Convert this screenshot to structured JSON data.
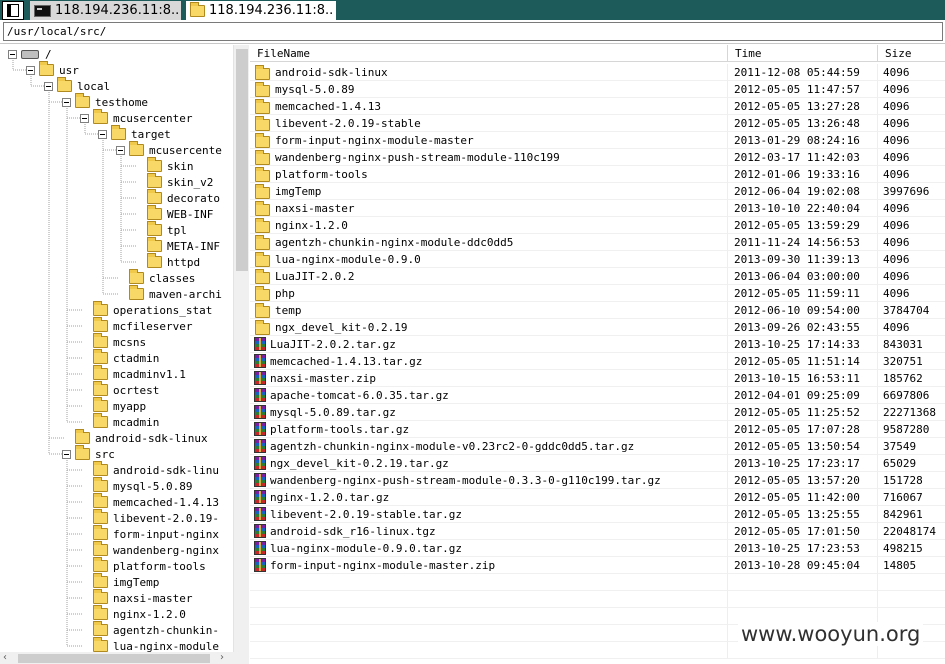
{
  "tabs": [
    {
      "label": "118.194.236.11:8..",
      "icon": "terminal-icon",
      "active": false
    },
    {
      "label": "118.194.236.11:8..",
      "icon": "folder-icon",
      "active": true
    }
  ],
  "path": "/usr/local/src/",
  "tree": [
    {
      "label": "/",
      "depth": 0,
      "expanded": true,
      "icon": "drive-icon"
    },
    {
      "label": "usr",
      "depth": 1,
      "expanded": true
    },
    {
      "label": "local",
      "depth": 2,
      "expanded": true
    },
    {
      "label": "testhome",
      "depth": 3,
      "expanded": true
    },
    {
      "label": "mcusercenter",
      "depth": 4,
      "expanded": true
    },
    {
      "label": "target",
      "depth": 5,
      "expanded": true
    },
    {
      "label": "mcusercente",
      "depth": 6,
      "expanded": true
    },
    {
      "label": "skin",
      "depth": 7
    },
    {
      "label": "skin_v2",
      "depth": 7
    },
    {
      "label": "decorato",
      "depth": 7
    },
    {
      "label": "WEB-INF",
      "depth": 7
    },
    {
      "label": "tpl",
      "depth": 7
    },
    {
      "label": "META-INF",
      "depth": 7
    },
    {
      "label": "httpd",
      "depth": 7
    },
    {
      "label": "classes",
      "depth": 6
    },
    {
      "label": "maven-archi",
      "depth": 6
    },
    {
      "label": "operations_stat",
      "depth": 4
    },
    {
      "label": "mcfileserver",
      "depth": 4
    },
    {
      "label": "mcsns",
      "depth": 4
    },
    {
      "label": "ctadmin",
      "depth": 4
    },
    {
      "label": "mcadminv1.1",
      "depth": 4
    },
    {
      "label": "ocrtest",
      "depth": 4
    },
    {
      "label": "myapp",
      "depth": 4
    },
    {
      "label": "mcadmin",
      "depth": 4
    },
    {
      "label": "android-sdk-linux",
      "depth": 3
    },
    {
      "label": "src",
      "depth": 3,
      "expanded": true
    },
    {
      "label": "android-sdk-linu",
      "depth": 4
    },
    {
      "label": "mysql-5.0.89",
      "depth": 4
    },
    {
      "label": "memcached-1.4.13",
      "depth": 4
    },
    {
      "label": "libevent-2.0.19-",
      "depth": 4
    },
    {
      "label": "form-input-nginx",
      "depth": 4
    },
    {
      "label": "wandenberg-nginx",
      "depth": 4
    },
    {
      "label": "platform-tools",
      "depth": 4
    },
    {
      "label": "imgTemp",
      "depth": 4
    },
    {
      "label": "naxsi-master",
      "depth": 4
    },
    {
      "label": "nginx-1.2.0",
      "depth": 4
    },
    {
      "label": "agentzh-chunkin-",
      "depth": 4
    },
    {
      "label": "lua-nginx-module",
      "depth": 4
    }
  ],
  "columns": {
    "name": "FileName",
    "time": "Time",
    "size": "Size"
  },
  "files": [
    {
      "name": "android-sdk-linux",
      "time": "2011-12-08 05:44:59",
      "size": "4096",
      "type": "folder"
    },
    {
      "name": "mysql-5.0.89",
      "time": "2012-05-05 11:47:57",
      "size": "4096",
      "type": "folder"
    },
    {
      "name": "memcached-1.4.13",
      "time": "2012-05-05 13:27:28",
      "size": "4096",
      "type": "folder"
    },
    {
      "name": "libevent-2.0.19-stable",
      "time": "2012-05-05 13:26:48",
      "size": "4096",
      "type": "folder"
    },
    {
      "name": "form-input-nginx-module-master",
      "time": "2013-01-29 08:24:16",
      "size": "4096",
      "type": "folder"
    },
    {
      "name": "wandenberg-nginx-push-stream-module-110c199",
      "time": "2012-03-17 11:42:03",
      "size": "4096",
      "type": "folder"
    },
    {
      "name": "platform-tools",
      "time": "2012-01-06 19:33:16",
      "size": "4096",
      "type": "folder"
    },
    {
      "name": "imgTemp",
      "time": "2012-06-04 19:02:08",
      "size": "3997696",
      "type": "folder"
    },
    {
      "name": "naxsi-master",
      "time": "2013-10-10 22:40:04",
      "size": "4096",
      "type": "folder"
    },
    {
      "name": "nginx-1.2.0",
      "time": "2012-05-05 13:59:29",
      "size": "4096",
      "type": "folder"
    },
    {
      "name": "agentzh-chunkin-nginx-module-ddc0dd5",
      "time": "2011-11-24 14:56:53",
      "size": "4096",
      "type": "folder"
    },
    {
      "name": "lua-nginx-module-0.9.0",
      "time": "2013-09-30 11:39:13",
      "size": "4096",
      "type": "folder"
    },
    {
      "name": "LuaJIT-2.0.2",
      "time": "2013-06-04 03:00:00",
      "size": "4096",
      "type": "folder"
    },
    {
      "name": "php",
      "time": "2012-05-05 11:59:11",
      "size": "4096",
      "type": "folder"
    },
    {
      "name": "temp",
      "time": "2012-06-10 09:54:00",
      "size": "3784704",
      "type": "folder"
    },
    {
      "name": "ngx_devel_kit-0.2.19",
      "time": "2013-09-26 02:43:55",
      "size": "4096",
      "type": "folder"
    },
    {
      "name": "LuaJIT-2.0.2.tar.gz",
      "time": "2013-10-25 17:14:33",
      "size": "843031",
      "type": "archive"
    },
    {
      "name": "memcached-1.4.13.tar.gz",
      "time": "2012-05-05 11:51:14",
      "size": "320751",
      "type": "archive"
    },
    {
      "name": "naxsi-master.zip",
      "time": "2013-10-15 16:53:11",
      "size": "185762",
      "type": "archive"
    },
    {
      "name": "apache-tomcat-6.0.35.tar.gz",
      "time": "2012-04-01 09:25:09",
      "size": "6697806",
      "type": "archive"
    },
    {
      "name": "mysql-5.0.89.tar.gz",
      "time": "2012-05-05 11:25:52",
      "size": "22271368",
      "type": "archive"
    },
    {
      "name": "platform-tools.tar.gz",
      "time": "2012-05-05 17:07:28",
      "size": "9587280",
      "type": "archive"
    },
    {
      "name": "agentzh-chunkin-nginx-module-v0.23rc2-0-gddc0dd5.tar.gz",
      "time": "2012-05-05 13:50:54",
      "size": "37549",
      "type": "archive"
    },
    {
      "name": "ngx_devel_kit-0.2.19.tar.gz",
      "time": "2013-10-25 17:23:17",
      "size": "65029",
      "type": "archive"
    },
    {
      "name": "wandenberg-nginx-push-stream-module-0.3.3-0-g110c199.tar.gz",
      "time": "2012-05-05 13:57:20",
      "size": "151728",
      "type": "archive"
    },
    {
      "name": "nginx-1.2.0.tar.gz",
      "time": "2012-05-05 11:42:00",
      "size": "716067",
      "type": "archive"
    },
    {
      "name": "libevent-2.0.19-stable.tar.gz",
      "time": "2012-05-05 13:25:55",
      "size": "842961",
      "type": "archive"
    },
    {
      "name": "android-sdk_r16-linux.tgz",
      "time": "2012-05-05 17:01:50",
      "size": "22048174",
      "type": "archive"
    },
    {
      "name": "lua-nginx-module-0.9.0.tar.gz",
      "time": "2013-10-25 17:23:53",
      "size": "498215",
      "type": "archive"
    },
    {
      "name": "form-input-nginx-module-master.zip",
      "time": "2013-10-28 09:45:04",
      "size": "14805",
      "type": "archive"
    }
  ],
  "watermark": "www.wooyun.org"
}
